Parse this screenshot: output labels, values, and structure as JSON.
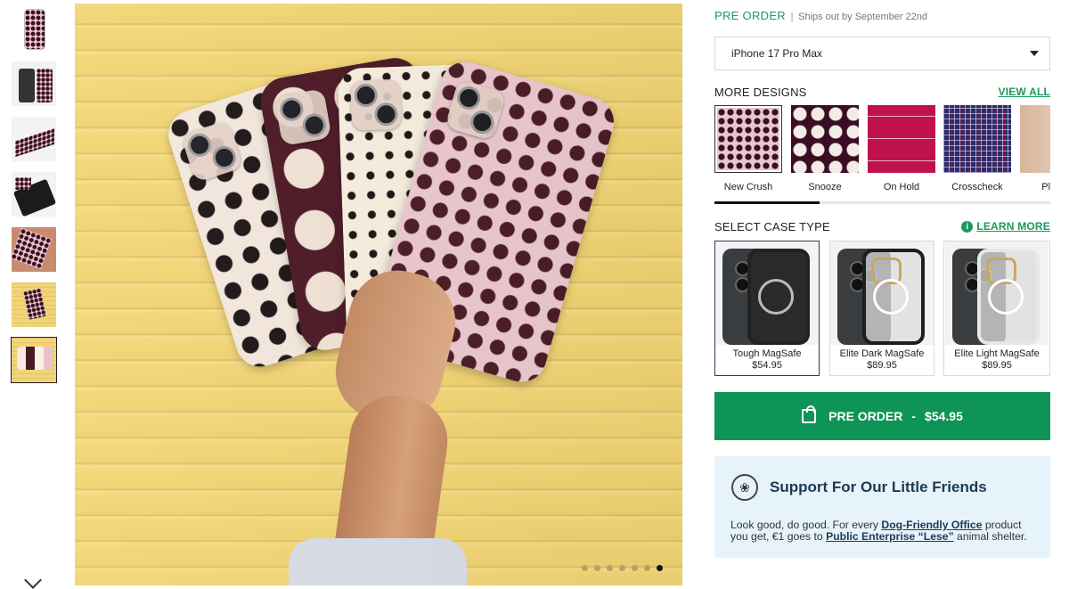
{
  "preorder": {
    "label": "PRE ORDER",
    "separator": "|",
    "ships": "Ships out by September 22nd"
  },
  "device": {
    "selected": "iPhone 17 Pro Max"
  },
  "designs": {
    "title": "MORE DESIGNS",
    "view_all": "VIEW ALL",
    "items": [
      {
        "name": "New Crush",
        "selected": true
      },
      {
        "name": "Snooze",
        "selected": false
      },
      {
        "name": "On Hold",
        "selected": false
      },
      {
        "name": "Crosscheck",
        "selected": false
      },
      {
        "name": "Playg",
        "selected": false
      }
    ],
    "scroll_fraction": 0.31
  },
  "case_type": {
    "title": "SELECT CASE TYPE",
    "learn_more": "LEARN MORE",
    "options": [
      {
        "name": "Tough MagSafe",
        "price": "$54.95",
        "selected": true
      },
      {
        "name": "Elite Dark MagSafe",
        "price": "$89.95",
        "selected": false
      },
      {
        "name": "Elite Light MagSafe",
        "price": "$89.95",
        "selected": false
      }
    ]
  },
  "buy_button": {
    "label": "PRE ORDER",
    "separator": "-",
    "price": "$54.95"
  },
  "support": {
    "title": "Support For Our Little Friends",
    "text_1": "Look good, do good. For every ",
    "link_1": "Dog-Friendly Office",
    "text_2": " product you get, €1 goes to ",
    "link_2": "Public Enterprise “Lese”",
    "text_3": " animal shelter."
  },
  "gallery": {
    "image_count": 7,
    "active_index": 6
  },
  "colors": {
    "accent_green": "#0f9457",
    "support_bg": "#e6f3fb"
  },
  "icons": [
    "shopping-bag-icon",
    "paw-icon",
    "info-icon",
    "chevron-down-icon",
    "caret-down-icon"
  ]
}
